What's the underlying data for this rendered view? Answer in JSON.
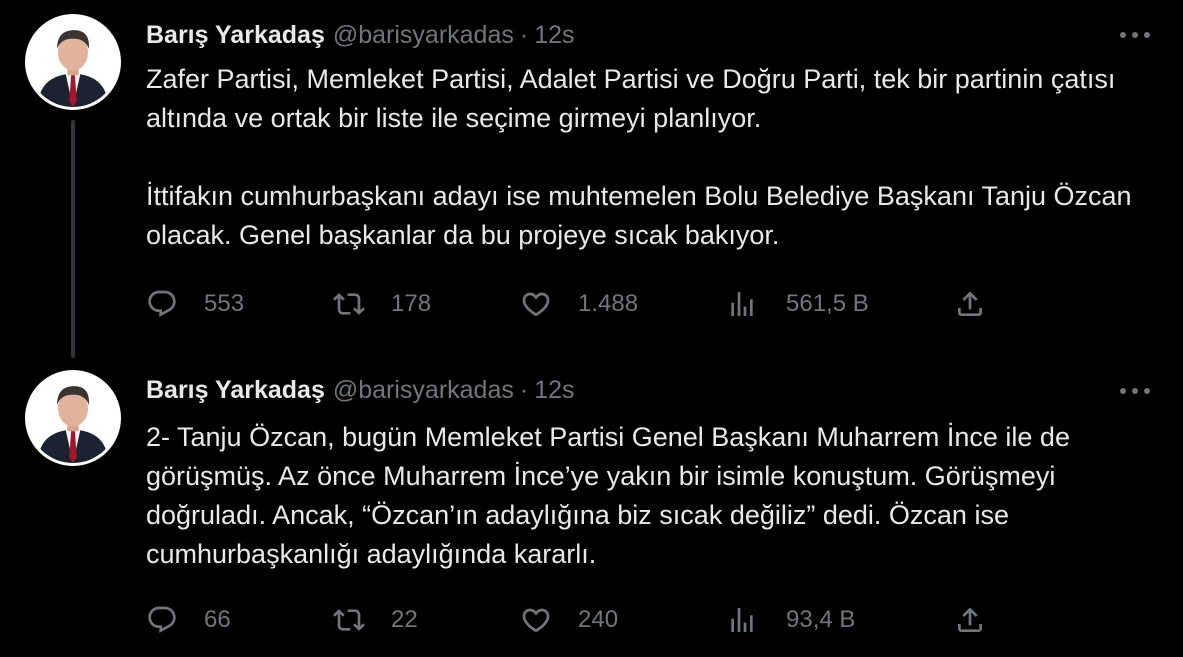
{
  "tweets": [
    {
      "author_name": "Barış Yarkadaş",
      "handle": "@barisyarkadas",
      "separator": "·",
      "time": "12s",
      "text": "Zafer Partisi, Memleket Partisi, Adalet Partisi ve Doğru Parti, tek bir partinin çatısı altında ve ortak bir liste ile seçime girmeyi planlıyor.\n\nİttifakın cumhurbaşkanı adayı ise muhtemelen Bolu Belediye Başkanı Tanju Özcan olacak. Genel başkanlar da bu projeye sıcak bakıyor.",
      "replies": "553",
      "retweets": "178",
      "likes": "1.488",
      "views": "561,5 B"
    },
    {
      "author_name": "Barış Yarkadaş",
      "handle": "@barisyarkadas",
      "separator": "·",
      "time": "12s",
      "text": "2- Tanju Özcan, bugün Memleket Partisi Genel Başkanı Muharrem İnce ile de görüşmüş. Az önce Muharrem İnce’ye yakın bir isimle konuştum. Görüşmeyi doğruladı. Ancak, “Özcan’ın adaylığına biz sıcak değiliz” dedi. Özcan ise cumhurbaşkanlığı adaylığında kararlı.",
      "replies": "66",
      "retweets": "22",
      "likes": "240",
      "views": "93,4 B"
    }
  ],
  "icons": {
    "more": "more-horizontal-icon",
    "reply": "reply-bubble-icon",
    "retweet": "retweet-icon",
    "like": "heart-icon",
    "views": "views-bar-chart-icon",
    "share": "share-upload-icon"
  },
  "colors": {
    "background": "#000000",
    "primary_text": "#e7e9ea",
    "secondary_text": "#71767b",
    "thread_line": "#333639"
  }
}
